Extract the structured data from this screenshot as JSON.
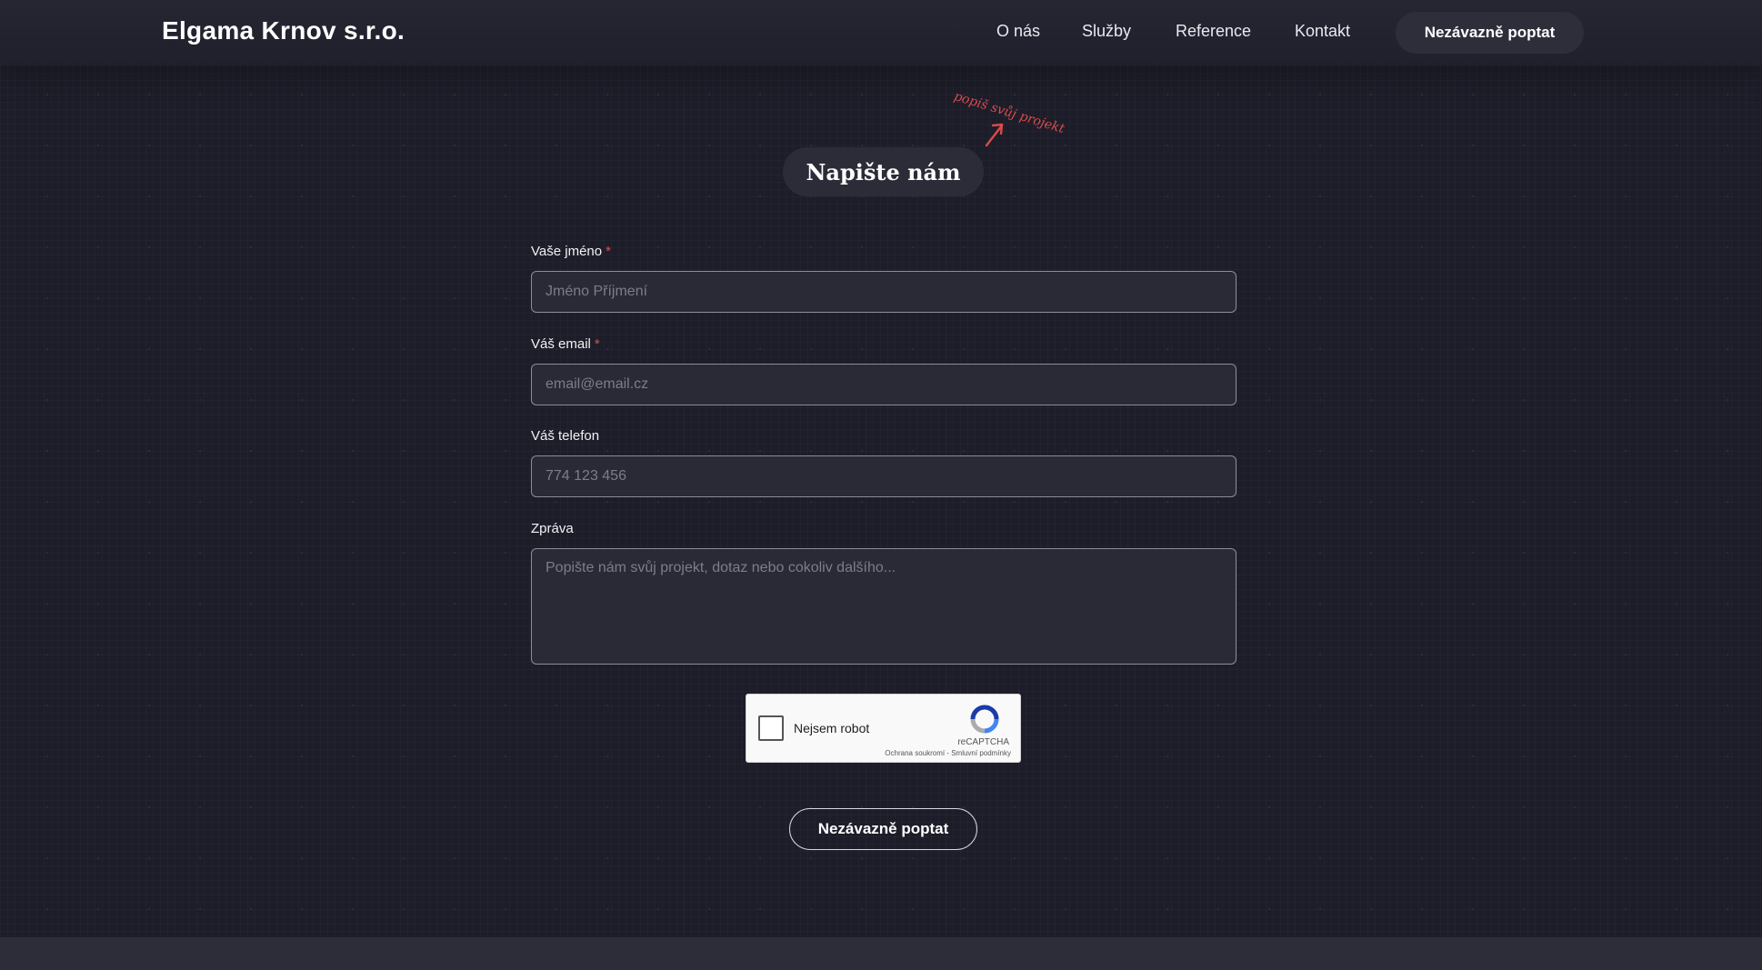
{
  "header": {
    "logo": "Elgama Krnov s.r.o.",
    "nav": [
      {
        "label": "O nás"
      },
      {
        "label": "Služby"
      },
      {
        "label": "Reference"
      },
      {
        "label": "Kontakt"
      }
    ],
    "cta_label": "Nezávazně poptat"
  },
  "section": {
    "annotation": "popiš svůj projekt",
    "title": "Napište nám"
  },
  "form": {
    "name": {
      "label": "Vaše jméno",
      "required_mark": "*",
      "placeholder": "Jméno Příjmení",
      "value": ""
    },
    "email": {
      "label": "Váš email",
      "required_mark": "*",
      "placeholder": "email@email.cz",
      "value": ""
    },
    "phone": {
      "label": "Váš telefon",
      "placeholder": "774 123 456",
      "value": ""
    },
    "message": {
      "label": "Zpráva",
      "placeholder": "Popište nám svůj projekt, dotaz nebo cokoliv dalšího...",
      "value": ""
    },
    "recaptcha": {
      "checkbox_label": "Nejsem robot",
      "brand": "reCAPTCHA",
      "links": "Ochrana soukromí - Smluvní podmínky"
    },
    "submit_label": "Nezávazně poptat"
  },
  "colors": {
    "background": "#1d1d29",
    "header": "#262633",
    "pill": "#2c2c38",
    "required": "#e14a4a",
    "annotation": "#d94b4b"
  }
}
